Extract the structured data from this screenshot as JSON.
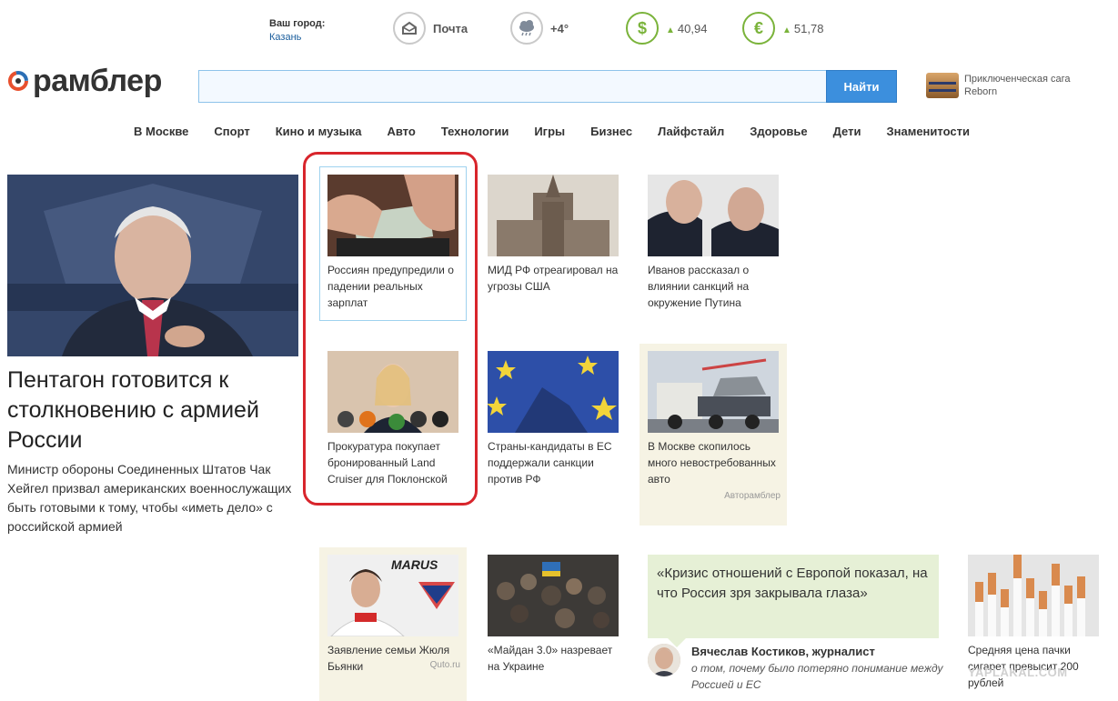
{
  "topbar": {
    "city_label": "Ваш город:",
    "city_value": "Казань",
    "mail_label": "Почта",
    "weather_value": "+4°",
    "dollar_value": "40,94",
    "euro_value": "51,78"
  },
  "logo": {
    "text": "рамблер"
  },
  "search": {
    "value": "",
    "button_label": "Найти"
  },
  "promo": {
    "line1": "Приключенческая сага",
    "line2": "Reborn"
  },
  "nav": [
    "В Москве",
    "Спорт",
    "Кино и музыка",
    "Авто",
    "Технологии",
    "Игры",
    "Бизнес",
    "Лайфстайл",
    "Здоровье",
    "Дети",
    "Знаменитости"
  ],
  "main_story": {
    "title": "Пентагон готовится к столкновению с армией России",
    "lead": "Министр обороны Соединенных Штатов Чак Хейгел призвал американских военнослужащих быть готовыми к тому, чтобы «иметь дело» с российской армией"
  },
  "tiles": [
    {
      "caption": "Россиян предупредили о падении реальных зарплат"
    },
    {
      "caption": "МИД РФ отреагировал на угрозы США"
    },
    {
      "caption": "Иванов рассказал о влиянии санкций на окружение Путина"
    },
    {
      "caption": "Прокуратура покупает бронированный Land Cruiser для Поклонской"
    },
    {
      "caption": "Страны-кандидаты в ЕС поддержали санкции против РФ"
    },
    {
      "caption": "В Москве скопилось много невостребованных авто",
      "source": "Авторамблер"
    },
    {
      "caption": "Заявление семьи Жюля Бьянки",
      "source": "Quto.ru"
    },
    {
      "caption": "«Майдан 3.0» назревает на Украине"
    },
    {
      "caption": "Средняя цена пачки сигарет превысит 200 рублей"
    }
  ],
  "quote": {
    "text": "«Кризис отношений с Европой показал, на что Россия зря закрывала глаза»",
    "author": "Вячеслав Костиков, журналист",
    "desc": "о том, почему было потеряно понимание между Россией и ЕС"
  },
  "watermark": "YAPLAKAL.COM",
  "colors": {
    "accent": "#3c8fdd",
    "highlight": "#d8252c",
    "currency": "#7ab33a"
  }
}
